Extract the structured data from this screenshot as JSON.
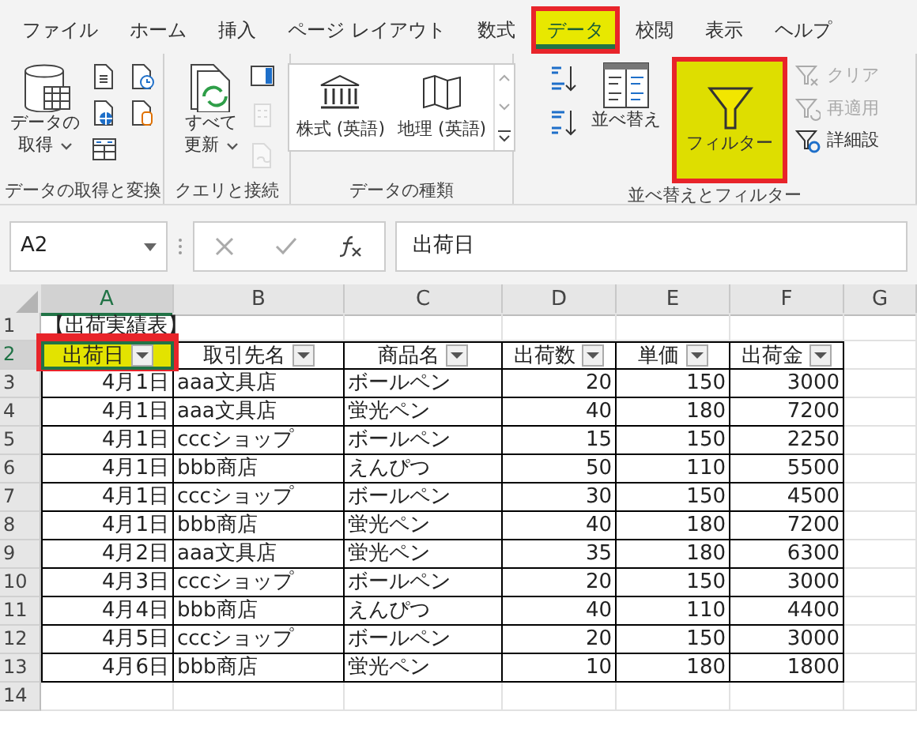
{
  "ribbon_tabs": [
    {
      "label": "ファイル",
      "selected": false,
      "highlighted": false
    },
    {
      "label": "ホーム",
      "selected": false,
      "highlighted": false
    },
    {
      "label": "挿入",
      "selected": false,
      "highlighted": false
    },
    {
      "label": "ページ レイアウト",
      "selected": false,
      "highlighted": false
    },
    {
      "label": "数式",
      "selected": false,
      "highlighted": false
    },
    {
      "label": "データ",
      "selected": true,
      "highlighted": true
    },
    {
      "label": "校閲",
      "selected": false,
      "highlighted": false
    },
    {
      "label": "表示",
      "selected": false,
      "highlighted": false
    },
    {
      "label": "ヘルプ",
      "selected": false,
      "highlighted": false
    }
  ],
  "ribbon_groups": [
    {
      "kind": "get",
      "label": "データの取得と変換",
      "large_button": {
        "lines": [
          "データの",
          "取得"
        ],
        "dropdown": true
      },
      "icon_buttons": [
        {
          "disabled": false
        },
        {
          "disabled": false
        },
        {
          "disabled": false
        },
        {
          "disabled": false
        },
        {
          "disabled": false
        }
      ]
    },
    {
      "kind": "queries",
      "label": "クエリと接続",
      "large_button": {
        "lines": [
          "すべて",
          "更新"
        ],
        "dropdown": true
      },
      "icon_buttons": [
        {
          "disabled": false
        },
        {
          "disabled": true
        },
        {
          "disabled": true
        }
      ]
    },
    {
      "kind": "types",
      "label": "データの種類",
      "gallery": [
        {
          "label": "株式 (英語)"
        },
        {
          "label": "地理 (英語)"
        }
      ]
    },
    {
      "kind": "sort",
      "label": "並べ替えとフィルター",
      "large_buttons": [
        {
          "label": "並べ替え",
          "highlighted": false
        },
        {
          "label": "フィルター",
          "highlighted": true
        }
      ],
      "small_buttons": [
        {
          "label": "クリア",
          "disabled": true
        },
        {
          "label": "再適用",
          "disabled": true
        },
        {
          "label": "詳細設",
          "disabled": false
        }
      ]
    }
  ],
  "formula_bar": {
    "name_box": "A2",
    "formula": "出荷日"
  },
  "column_headers": [
    {
      "label": "A",
      "selected": true
    },
    {
      "label": "B",
      "selected": false
    },
    {
      "label": "C",
      "selected": false
    },
    {
      "label": "D",
      "selected": false
    },
    {
      "label": "E",
      "selected": false
    },
    {
      "label": "F",
      "selected": false
    },
    {
      "label": "G",
      "selected": false
    }
  ],
  "rows": [
    {
      "number": "1",
      "selected": false,
      "title": "【出荷実績表】"
    },
    {
      "number": "2",
      "selected": true,
      "header_cells": [
        {
          "text": "出荷日",
          "highlighted": true
        },
        {
          "text": "取引先名",
          "highlighted": false
        },
        {
          "text": "商品名",
          "highlighted": false
        },
        {
          "text": "出荷数",
          "highlighted": false
        },
        {
          "text": "単価",
          "highlighted": false
        },
        {
          "text": "出荷金",
          "highlighted": false
        }
      ]
    },
    {
      "number": "3",
      "selected": false,
      "cells": [
        "4月1日",
        "aaa文具店",
        "ボールペン",
        "20",
        "150",
        "3000"
      ]
    },
    {
      "number": "4",
      "selected": false,
      "cells": [
        "4月1日",
        "aaa文具店",
        "蛍光ペン",
        "40",
        "180",
        "7200"
      ]
    },
    {
      "number": "5",
      "selected": false,
      "cells": [
        "4月1日",
        "cccショップ",
        "ボールペン",
        "15",
        "150",
        "2250"
      ]
    },
    {
      "number": "6",
      "selected": false,
      "cells": [
        "4月1日",
        "bbb商店",
        "えんぴつ",
        "50",
        "110",
        "5500"
      ]
    },
    {
      "number": "7",
      "selected": false,
      "cells": [
        "4月1日",
        "cccショップ",
        "ボールペン",
        "30",
        "150",
        "4500"
      ]
    },
    {
      "number": "8",
      "selected": false,
      "cells": [
        "4月1日",
        "bbb商店",
        "蛍光ペン",
        "40",
        "180",
        "7200"
      ]
    },
    {
      "number": "9",
      "selected": false,
      "cells": [
        "4月2日",
        "aaa文具店",
        "蛍光ペン",
        "35",
        "180",
        "6300"
      ]
    },
    {
      "number": "10",
      "selected": false,
      "cells": [
        "4月3日",
        "cccショップ",
        "ボールペン",
        "20",
        "150",
        "3000"
      ]
    },
    {
      "number": "11",
      "selected": false,
      "cells": [
        "4月4日",
        "bbb商店",
        "えんぴつ",
        "40",
        "110",
        "4400"
      ]
    },
    {
      "number": "12",
      "selected": false,
      "cells": [
        "4月5日",
        "cccショップ",
        "ボールペン",
        "20",
        "150",
        "3000"
      ]
    },
    {
      "number": "13",
      "selected": false,
      "cells": [
        "4月6日",
        "bbb商店",
        "蛍光ペン",
        "10",
        "180",
        "1800"
      ]
    },
    {
      "number": "14",
      "selected": false
    }
  ]
}
